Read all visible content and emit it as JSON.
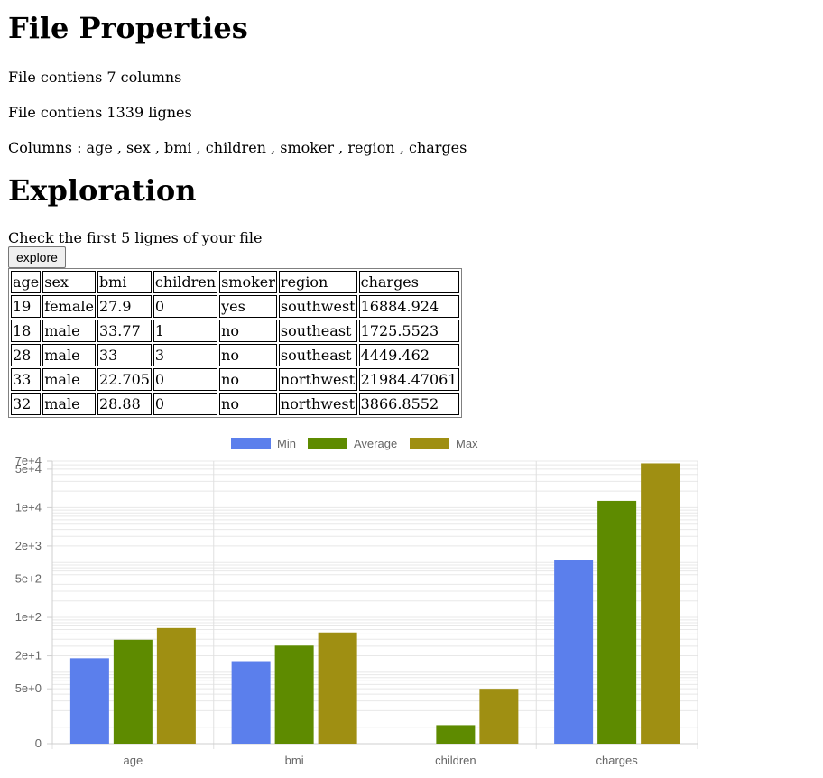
{
  "page": {
    "title_file": "File Properties",
    "info_cols": "File contiens 7 columns",
    "info_rows": "File contiens 1339 lignes",
    "info_colnames": "Columns : age , sex , bmi , children , smoker , region , charges",
    "title_exploration": "Exploration",
    "check_text": "Check the first 5 lignes of your file",
    "explore_label": "explore"
  },
  "table": {
    "headers": [
      "age",
      "sex",
      "bmi",
      "children",
      "smoker",
      "region",
      "charges"
    ],
    "rows": [
      [
        "19",
        "female",
        "27.9",
        "0",
        "yes",
        "southwest",
        "16884.924"
      ],
      [
        "18",
        "male",
        "33.77",
        "1",
        "no",
        "southeast",
        "1725.5523"
      ],
      [
        "28",
        "male",
        "33",
        "3",
        "no",
        "southeast",
        "4449.462"
      ],
      [
        "33",
        "male",
        "22.705",
        "0",
        "no",
        "northwest",
        "21984.47061"
      ],
      [
        "32",
        "male",
        "28.88",
        "0",
        "no",
        "northwest",
        "3866.8552"
      ]
    ]
  },
  "chart_data": {
    "type": "bar",
    "yscale": "log",
    "categories": [
      "age",
      "bmi",
      "children",
      "charges"
    ],
    "series": [
      {
        "name": "Min",
        "color": "#5b7fec",
        "values": [
          18,
          15.96,
          0,
          1121.8739
        ]
      },
      {
        "name": "Average",
        "color": "#5e8b00",
        "values": [
          39.2,
          30.66,
          1.09,
          13270.42
        ]
      },
      {
        "name": "Max",
        "color": "#9f8f12",
        "values": [
          64,
          53.13,
          5,
          63770.43
        ]
      }
    ],
    "yticks": [
      "0",
      "5e+0",
      "2e+1",
      "1e+2",
      "5e+2",
      "2e+3",
      "1e+4",
      "5e+4",
      "7e+4"
    ],
    "legend": "top-center",
    "grid": true
  }
}
